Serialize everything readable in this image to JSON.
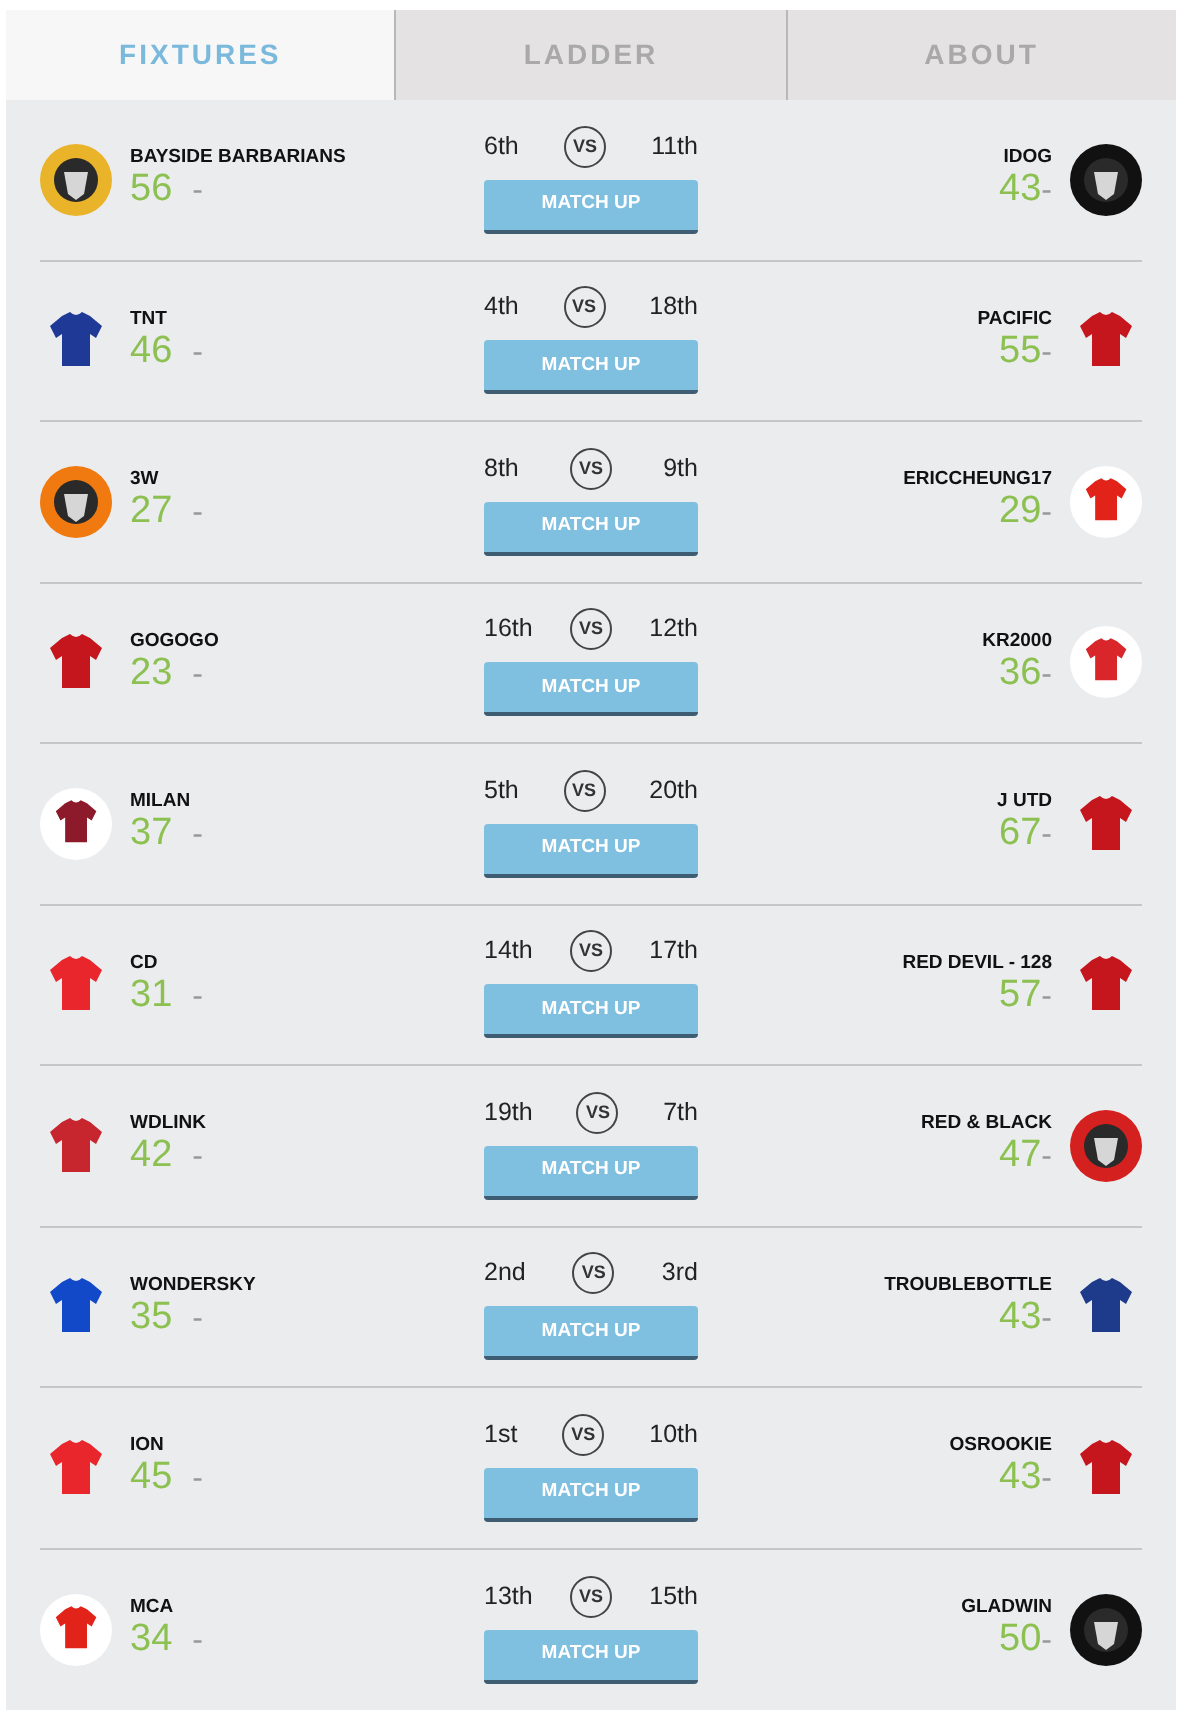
{
  "tabs": [
    {
      "label": "FIXTURES",
      "selected": true
    },
    {
      "label": "LADDER",
      "selected": false
    },
    {
      "label": "ABOUT",
      "selected": false
    }
  ],
  "fixtures": [
    {
      "home": {
        "name": "BAYSIDE BARBARIANS",
        "score": "56",
        "result": "-",
        "rank": "6th",
        "avatar": {
          "kind": "badge",
          "color": "#e9b32a"
        }
      },
      "vs": "VS",
      "button": "MATCH UP",
      "away": {
        "name": "IDOG",
        "score": "43",
        "result": "-",
        "rank": "11th",
        "avatar": {
          "kind": "badge",
          "color": "#111111"
        }
      }
    },
    {
      "home": {
        "name": "TNT",
        "score": "46",
        "result": "-",
        "rank": "4th",
        "avatar": {
          "kind": "jersey",
          "color": "#1e3a96"
        }
      },
      "vs": "VS",
      "button": "MATCH UP",
      "away": {
        "name": "PACIFIC",
        "score": "55",
        "result": "-",
        "rank": "18th",
        "avatar": {
          "kind": "jersey",
          "color": "#c4161c"
        }
      }
    },
    {
      "home": {
        "name": "3W",
        "score": "27",
        "result": "-",
        "rank": "8th",
        "avatar": {
          "kind": "badge",
          "color": "#f07a10"
        }
      },
      "vs": "VS",
      "button": "MATCH UP",
      "away": {
        "name": "ERICCHEUNG17",
        "score": "29",
        "result": "-",
        "rank": "9th",
        "avatar": {
          "kind": "framed",
          "color": "#e2231a"
        }
      }
    },
    {
      "home": {
        "name": "GOGOGO",
        "score": "23",
        "result": "-",
        "rank": "16th",
        "avatar": {
          "kind": "jersey",
          "color": "#c4161c"
        }
      },
      "vs": "VS",
      "button": "MATCH UP",
      "away": {
        "name": "KR2000",
        "score": "36",
        "result": "-",
        "rank": "12th",
        "avatar": {
          "kind": "framed",
          "color": "#d9262b"
        }
      }
    },
    {
      "home": {
        "name": "MILAN",
        "score": "37",
        "result": "-",
        "rank": "5th",
        "avatar": {
          "kind": "framed",
          "color": "#8c1a2a"
        }
      },
      "vs": "VS",
      "button": "MATCH UP",
      "away": {
        "name": "J UTD",
        "score": "67",
        "result": "-",
        "rank": "20th",
        "avatar": {
          "kind": "jersey",
          "color": "#c4161c"
        }
      }
    },
    {
      "home": {
        "name": "CD",
        "score": "31",
        "result": "-",
        "rank": "14th",
        "avatar": {
          "kind": "jersey",
          "color": "#e8262b"
        }
      },
      "vs": "VS",
      "button": "MATCH UP",
      "away": {
        "name": "RED DEVIL - 128",
        "score": "57",
        "result": "-",
        "rank": "17th",
        "avatar": {
          "kind": "jersey",
          "color": "#c4161c"
        }
      }
    },
    {
      "home": {
        "name": "WDLINK",
        "score": "42",
        "result": "-",
        "rank": "19th",
        "avatar": {
          "kind": "jersey",
          "color": "#c8262f"
        }
      },
      "vs": "VS",
      "button": "MATCH UP",
      "away": {
        "name": "RED & BLACK",
        "score": "47",
        "result": "-",
        "rank": "7th",
        "avatar": {
          "kind": "badge",
          "color": "#d4201e"
        }
      }
    },
    {
      "home": {
        "name": "WONDERSKY",
        "score": "35",
        "result": "-",
        "rank": "2nd",
        "avatar": {
          "kind": "jersey",
          "color": "#1249c8"
        }
      },
      "vs": "VS",
      "button": "MATCH UP",
      "away": {
        "name": "TROUBLEBOTTLE",
        "score": "43",
        "result": "-",
        "rank": "3rd",
        "avatar": {
          "kind": "jersey",
          "color": "#1e3a8a"
        }
      }
    },
    {
      "home": {
        "name": "ION",
        "score": "45",
        "result": "-",
        "rank": "1st",
        "avatar": {
          "kind": "jersey",
          "color": "#e8262b"
        }
      },
      "vs": "VS",
      "button": "MATCH UP",
      "away": {
        "name": "OSROOKIE",
        "score": "43",
        "result": "-",
        "rank": "10th",
        "avatar": {
          "kind": "jersey",
          "color": "#c4161c"
        }
      }
    },
    {
      "home": {
        "name": "MCA",
        "score": "34",
        "result": "-",
        "rank": "13th",
        "avatar": {
          "kind": "framed",
          "color": "#e2231a"
        }
      },
      "vs": "VS",
      "button": "MATCH UP",
      "away": {
        "name": "GLADWIN",
        "score": "50",
        "result": "-",
        "rank": "15th",
        "avatar": {
          "kind": "badge",
          "color": "#111111"
        }
      }
    }
  ]
}
